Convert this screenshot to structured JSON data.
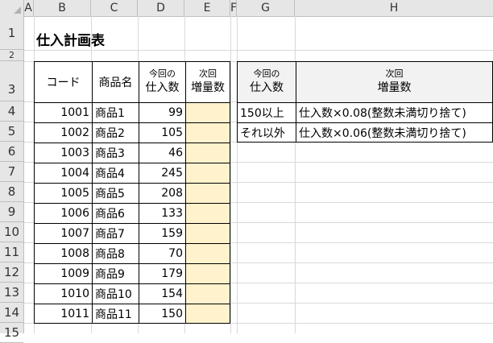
{
  "columns": [
    "A",
    "B",
    "C",
    "D",
    "E",
    "F",
    "G",
    "H"
  ],
  "rows": [
    "1",
    "2",
    "3",
    "4",
    "5",
    "6",
    "7",
    "8",
    "9",
    "10",
    "11",
    "12",
    "13",
    "14",
    "15"
  ],
  "title": "仕入計画表",
  "main_table": {
    "headers": {
      "code": "コード",
      "name": "商品名",
      "current_line1": "今回の",
      "current_line2": "仕入数",
      "next_line1": "次回",
      "next_line2": "増量数"
    },
    "rows": [
      {
        "code": "1001",
        "name": "商品1",
        "qty": "99",
        "next": ""
      },
      {
        "code": "1002",
        "name": "商品2",
        "qty": "105",
        "next": ""
      },
      {
        "code": "1003",
        "name": "商品3",
        "qty": "46",
        "next": ""
      },
      {
        "code": "1004",
        "name": "商品4",
        "qty": "245",
        "next": ""
      },
      {
        "code": "1005",
        "name": "商品5",
        "qty": "208",
        "next": ""
      },
      {
        "code": "1006",
        "name": "商品6",
        "qty": "133",
        "next": ""
      },
      {
        "code": "1007",
        "name": "商品7",
        "qty": "159",
        "next": ""
      },
      {
        "code": "1008",
        "name": "商品8",
        "qty": "70",
        "next": ""
      },
      {
        "code": "1009",
        "name": "商品9",
        "qty": "179",
        "next": ""
      },
      {
        "code": "1010",
        "name": "商品10",
        "qty": "154",
        "next": ""
      },
      {
        "code": "1011",
        "name": "商品11",
        "qty": "150",
        "next": ""
      }
    ]
  },
  "rule_table": {
    "headers": {
      "current_line1": "今回の",
      "current_line2": "仕入数",
      "next_line1": "次回",
      "next_line2": "増量数"
    },
    "rows": [
      {
        "condition": "150以上",
        "formula": "仕入数×0.08(整数未満切り捨て)"
      },
      {
        "condition": "それ以外",
        "formula": "仕入数×0.06(整数未満切り捨て)"
      }
    ]
  },
  "colors": {
    "input_fill": "#fff2cc",
    "header_fill": "#f2f2f2",
    "gridline": "#d9d9d9",
    "heading_bg": "#e6e6e6"
  }
}
